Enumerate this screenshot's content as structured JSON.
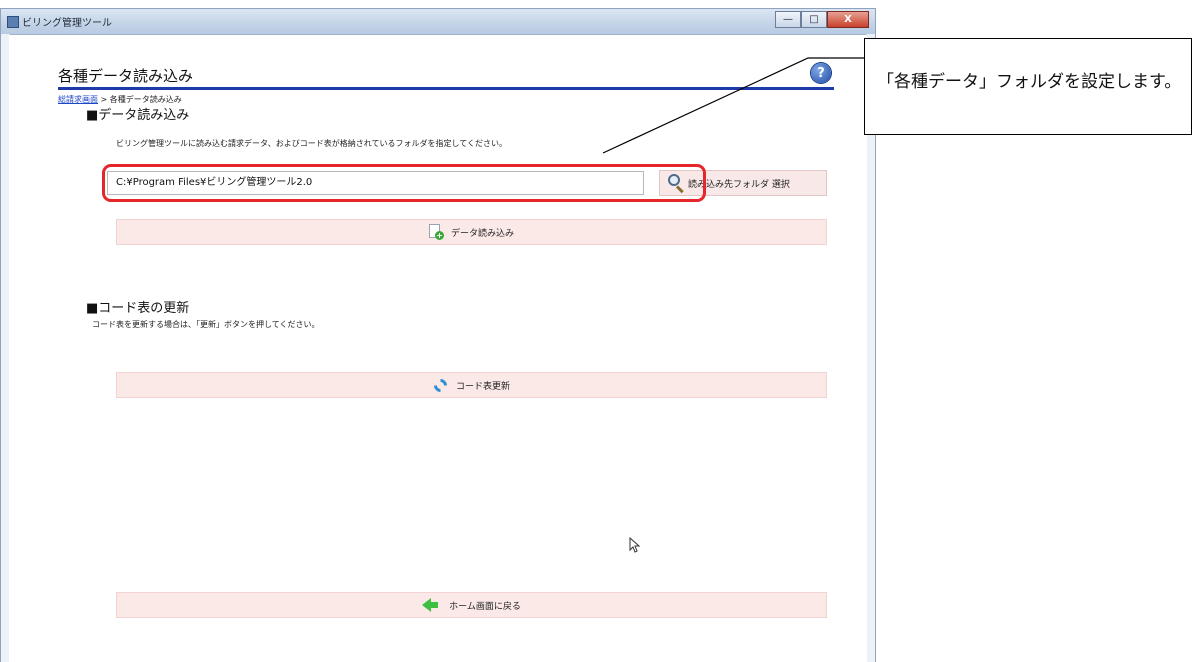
{
  "window": {
    "title": "ビリング管理ツール"
  },
  "window_controls": {
    "minimize": "—",
    "maximize": "□",
    "close": "X"
  },
  "page": {
    "title": "各種データ読み込み",
    "help_symbol": "?",
    "breadcrumb_link": "総請求画面",
    "breadcrumb_rest": "> 各種データ読み込み"
  },
  "data_section": {
    "heading": "■データ読み込み",
    "hint": "ビリング管理ツールに読み込む請求データ、およびコード表が格納されているフォルダを指定してください。",
    "folder_path": "C:¥Program Files¥ビリング管理ツール2.0",
    "folder_button_label": "読み込み先フォルダ 選択",
    "load_button_label": "データ読み込み"
  },
  "code_section": {
    "heading": "■コード表の更新",
    "hint": "コード表を更新する場合は、「更新」ボタンを押してください。",
    "update_button_label": "コード表更新"
  },
  "footer": {
    "home_button_label": "ホーム画面に戻る"
  },
  "annotation": {
    "callout_text": "「各種データ」フォルダを設定します。",
    "highlight_color": "#e5262b"
  },
  "colors": {
    "title_rule": "#1d3aa8",
    "button_bg": "#fbe9e8"
  }
}
